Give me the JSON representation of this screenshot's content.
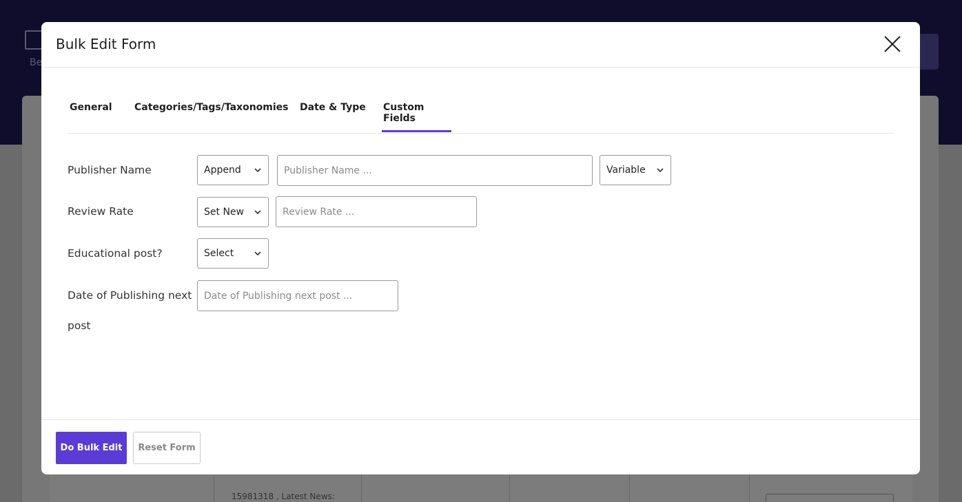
{
  "background": {
    "logo_text": "Be",
    "table_cell_text": "15981318 , Latest News:"
  },
  "modal": {
    "title": "Bulk Edit Form",
    "close_icon": "close-icon"
  },
  "tabs": [
    {
      "label": "General",
      "active": false
    },
    {
      "label": "Categories/Tags/Taxonomies",
      "active": false
    },
    {
      "label": "Date & Type",
      "active": false
    },
    {
      "label": "Custom Fields",
      "active": true
    }
  ],
  "fields": {
    "publisher_name": {
      "label": "Publisher Name",
      "action": "Append",
      "placeholder": "Publisher Name ...",
      "variable": "Variable"
    },
    "review_rate": {
      "label": "Review Rate",
      "action": "Set New",
      "placeholder": "Review Rate ..."
    },
    "educational_post": {
      "label": "Educational post?",
      "value": "Select"
    },
    "date_of_publishing": {
      "label_line1": "Date of Publishing next",
      "label_line2": "post",
      "placeholder": "Date of Publishing next post ..."
    }
  },
  "footer": {
    "submit_label": "Do Bulk Edit",
    "reset_label": "Reset Form"
  },
  "colors": {
    "accent": "#5b3bd6",
    "header_bg": "#0f0d2b"
  }
}
